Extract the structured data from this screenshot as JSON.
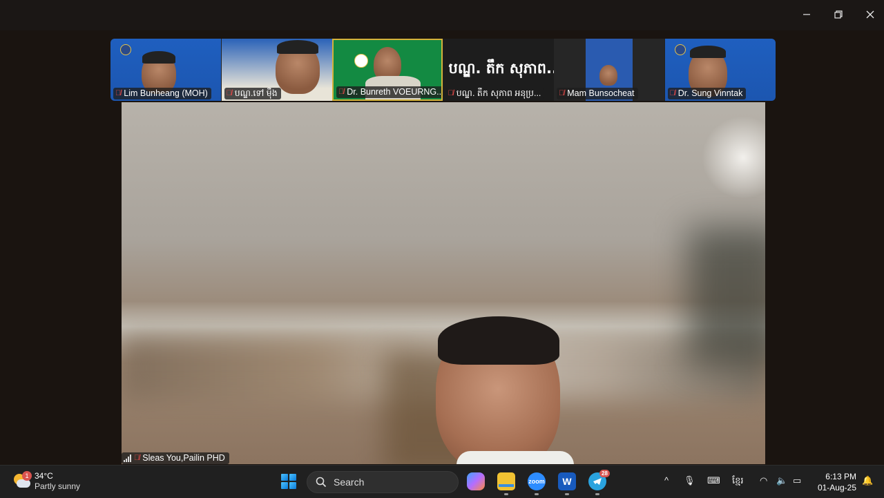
{
  "window": {
    "minimize_icon": "minimize-icon",
    "restore_icon": "restore-icon",
    "close_icon": "close-icon"
  },
  "participants": [
    {
      "name": "Lim Bunheang (MOH)",
      "muted": true
    },
    {
      "name": "បណ្ឌ.ទៅ ម៉ឹង",
      "muted": true
    },
    {
      "name": "Dr. Bunreth VOEURNG...",
      "muted": true,
      "active_speaker": true
    },
    {
      "name": "បណ្ឌ. តឹក សុភាព អនុប្រ...",
      "muted": true,
      "big_label": "បណ្ឌ. តឹក សុភាព..."
    },
    {
      "name": "Mam Bunsocheat",
      "muted": true
    },
    {
      "name": "Dr. Sung Vinntak",
      "muted": true
    }
  ],
  "main_speaker": {
    "name": "Sleas You,Pailin PHD",
    "muted": true
  },
  "taskbar": {
    "weather": {
      "badge": "1",
      "temp": "34°C",
      "desc": "Partly sunny"
    },
    "search_label": "Search",
    "apps": [
      {
        "name": "copilot-icon"
      },
      {
        "name": "file-explorer-icon"
      },
      {
        "name": "zoom-icon",
        "label": "zoom"
      },
      {
        "name": "word-icon",
        "label": "W"
      },
      {
        "name": "telegram-icon",
        "badge": "28"
      }
    ],
    "tray": {
      "language": "ខ្មែរ"
    },
    "clock": {
      "time": "6:13 PM",
      "date": "01-Aug-25"
    }
  }
}
